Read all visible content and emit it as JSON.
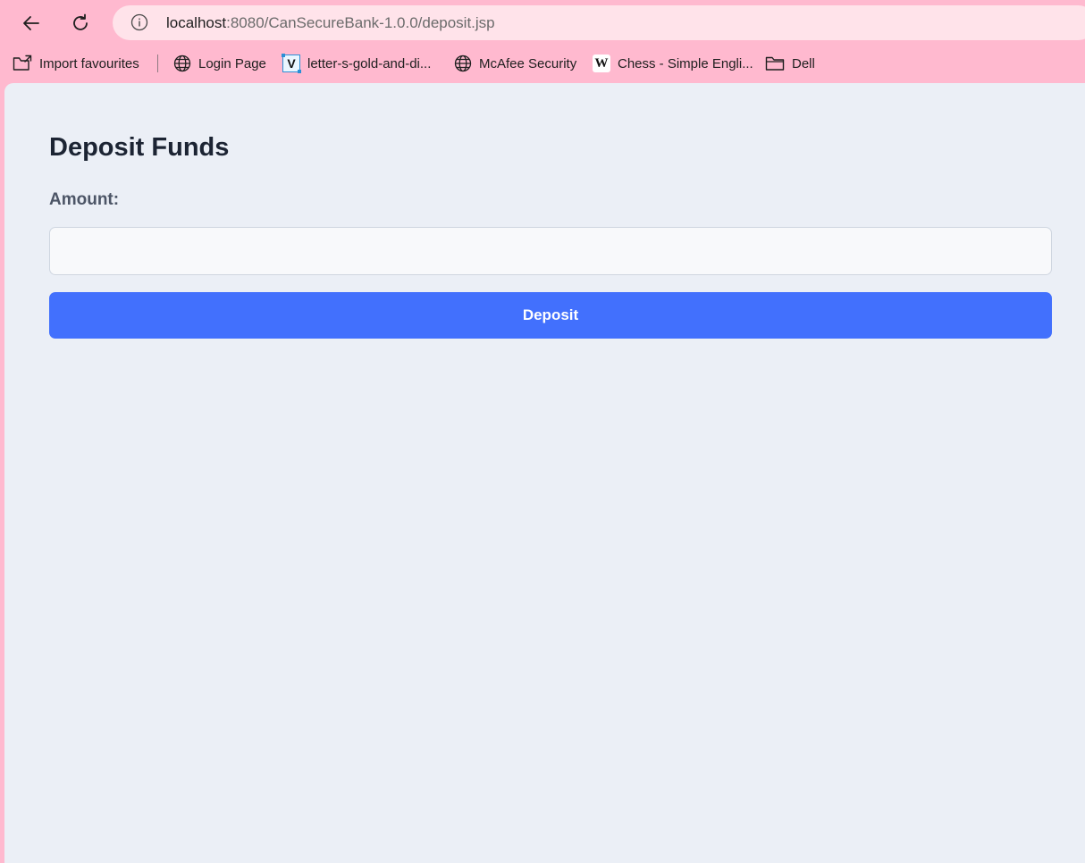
{
  "browser": {
    "url_host": "localhost",
    "url_path": ":8080/CanSecureBank-1.0.0/deposit.jsp",
    "back_icon": "arrow-left-icon",
    "reload_icon": "reload-icon",
    "info_icon": "info-icon"
  },
  "bookmarks": [
    {
      "label": "Import favourites",
      "icon": "import-folder-icon"
    },
    {
      "label": "Login Page",
      "icon": "globe-icon"
    },
    {
      "label": "letter-s-gold-and-di...",
      "icon": "vector-logo-icon"
    },
    {
      "label": "McAfee Security",
      "icon": "globe-icon"
    },
    {
      "label": "Chess - Simple Engli...",
      "icon": "wikipedia-icon"
    },
    {
      "label": "Dell",
      "icon": "folder-icon"
    }
  ],
  "icon_glyphs": {
    "wikipedia": "W",
    "vector_logo": "V"
  },
  "page": {
    "title": "Deposit Funds",
    "amount_label": "Amount:",
    "amount_value": "",
    "deposit_label": "Deposit"
  },
  "colors": {
    "browser_frame": "#ffb9cf",
    "address_bar": "#ffe3ea",
    "page_background": "#ebeff6",
    "button_primary": "#4270fd",
    "button_text": "#ffffff",
    "title_text": "#1c2433",
    "label_text": "#4c5566"
  }
}
